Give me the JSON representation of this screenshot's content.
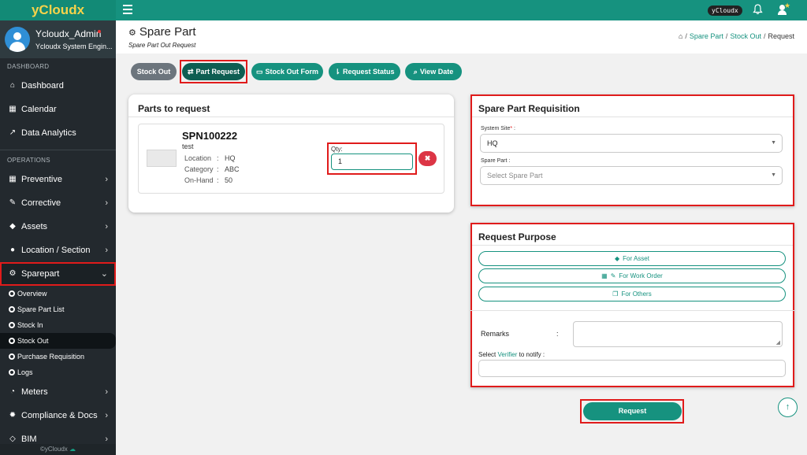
{
  "app": {
    "brand": "yCloudx",
    "topbar_badge": "yCloudx"
  },
  "profile": {
    "name": "Ycloudx_Admin",
    "role": "Ycloudx System Engin..."
  },
  "sidebar": {
    "section_dashboard": "DASHBOARD",
    "section_operations": "OPERATIONS",
    "items": [
      {
        "label": "Dashboard"
      },
      {
        "label": "Calendar"
      },
      {
        "label": "Data Analytics"
      },
      {
        "label": "Preventive"
      },
      {
        "label": "Corrective"
      },
      {
        "label": "Assets"
      },
      {
        "label": "Location / Section"
      },
      {
        "label": "Sparepart"
      },
      {
        "label": "Meters"
      },
      {
        "label": "Compliance & Docs"
      },
      {
        "label": "BIM"
      }
    ],
    "subitems": [
      {
        "label": "Overview"
      },
      {
        "label": "Spare Part List"
      },
      {
        "label": "Stock In"
      },
      {
        "label": "Stock Out"
      },
      {
        "label": "Purchase Requisition"
      },
      {
        "label": "Logs"
      }
    ],
    "footer": "©yCloudx"
  },
  "header": {
    "title": "Spare Part",
    "subtitle": "Spare Part Out Request",
    "breadcrumb": [
      "Spare Part",
      "Stock Out",
      "Request"
    ]
  },
  "actions": {
    "stock_out": "Stock Out",
    "part_request": "Part Request",
    "stock_out_form": "Stock Out Form",
    "request_status": "Request Status",
    "view_date": "View Date"
  },
  "parts": {
    "title": "Parts to request",
    "item": {
      "code": "SPN100222",
      "name": "test",
      "location_label": "Location",
      "location": "HQ",
      "category_label": "Category",
      "category": "ABC",
      "onhand_label": "On-Hand",
      "onhand": "50",
      "qty_label": "Qty:",
      "qty": "1"
    }
  },
  "requisition": {
    "title": "Spare Part Requisition",
    "site_label": "System Site",
    "site_value": "HQ",
    "part_label": "Spare Part :",
    "part_placeholder": "Select Spare Part"
  },
  "purpose": {
    "title": "Request Purpose",
    "for_asset": "For Asset",
    "for_work_order": "For Work Order",
    "for_others": "For Others",
    "remarks_label": "Remarks",
    "verifier_prefix": "Select",
    "verifier_link": "Verifier",
    "verifier_suffix": "to notify :"
  },
  "submit": {
    "request": "Request"
  },
  "colors": {
    "primary": "#16927f",
    "sidebar": "#23292e",
    "brand_text": "#f7d34a",
    "highlight": "#e01b1b",
    "danger": "#dc3545"
  }
}
